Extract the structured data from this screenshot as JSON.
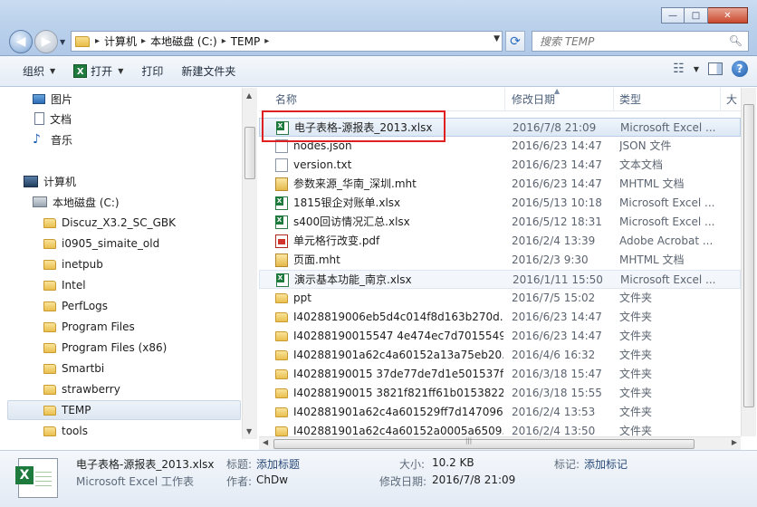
{
  "window": {
    "minimize_glyph": "—",
    "maximize_glyph": "□",
    "close_glyph": "✕"
  },
  "address": {
    "crumbs": [
      "计算机",
      "本地磁盘 (C:)",
      "TEMP"
    ],
    "separator": "▸"
  },
  "search": {
    "placeholder": "搜索 TEMP"
  },
  "toolbar": {
    "organize": "组织",
    "open": "打开",
    "print": "打印",
    "new_folder": "新建文件夹"
  },
  "nav": {
    "pictures": "图片",
    "documents": "文档",
    "music": "音乐",
    "computer": "计算机",
    "local_disk": "本地磁盘 (C:)",
    "folders": [
      "Discuz_X3.2_SC_GBK",
      "i0905_simaite_old",
      "inetpub",
      "Intel",
      "PerfLogs",
      "Program Files",
      "Program Files (x86)",
      "Smartbi",
      "strawberry",
      "TEMP",
      "tools"
    ]
  },
  "columns": {
    "name": "名称",
    "date": "修改日期",
    "type": "类型",
    "size": "大"
  },
  "files": [
    {
      "name": "电子表格-源报表_2013.xlsx",
      "date": "2016/7/8 21:09",
      "type": "Microsoft Excel ...",
      "icon": "excel-icon"
    },
    {
      "name": "nodes.json",
      "date": "2016/6/23 14:47",
      "type": "JSON 文件",
      "icon": "json-file-icon"
    },
    {
      "name": "version.txt",
      "date": "2016/6/23 14:47",
      "type": "文本文档",
      "icon": "text-file-icon"
    },
    {
      "name": "参数来源_华南_深圳.mht",
      "date": "2016/6/23 14:47",
      "type": "MHTML 文档",
      "icon": "mht-file-icon"
    },
    {
      "name": "1815银企对账单.xlsx",
      "date": "2016/5/13 10:18",
      "type": "Microsoft Excel ...",
      "icon": "excel-icon"
    },
    {
      "name": "s400回访情况汇总.xlsx",
      "date": "2016/5/12 18:31",
      "type": "Microsoft Excel ...",
      "icon": "excel-icon"
    },
    {
      "name": "单元格行改变.pdf",
      "date": "2016/2/4 13:39",
      "type": "Adobe Acrobat ...",
      "icon": "pdf-icon"
    },
    {
      "name": "页面.mht",
      "date": "2016/2/3 9:30",
      "type": "MHTML 文档",
      "icon": "mht-file-icon"
    },
    {
      "name": "演示基本功能_南京.xlsx",
      "date": "2016/1/11 15:50",
      "type": "Microsoft Excel ...",
      "icon": "excel-icon"
    },
    {
      "name": "ppt",
      "date": "2016/7/5 15:02",
      "type": "文件夹",
      "icon": "folder-icon"
    },
    {
      "name": "I4028819006eb5d4c014f8d163b270d...",
      "date": "2016/6/23 14:47",
      "type": "文件夹",
      "icon": "folder-icon"
    },
    {
      "name": "I40288190015547 4e474ec7d7015549...",
      "date": "2016/6/23 14:47",
      "type": "文件夹",
      "icon": "folder-icon"
    },
    {
      "name": "I402881901a62c4a60152a13a75eb20...",
      "date": "2016/4/6 16:32",
      "type": "文件夹",
      "icon": "folder-icon"
    },
    {
      "name": "I40288190015 37de77de7d1e501537f...",
      "date": "2016/3/18 15:47",
      "type": "文件夹",
      "icon": "folder-icon"
    },
    {
      "name": "I40288190015 3821f821ff61b0153822...",
      "date": "2016/3/18 15:55",
      "type": "文件夹",
      "icon": "folder-icon"
    },
    {
      "name": "I402881901a62c4a601529ff7d147096d",
      "date": "2016/2/4 13:53",
      "type": "文件夹",
      "icon": "folder-icon"
    },
    {
      "name": "I402881901a62c4a60152a0005a6509...",
      "date": "2016/2/4 13:50",
      "type": "文件夹",
      "icon": "folder-icon"
    }
  ],
  "details": {
    "filename": "电子表格-源报表_2013.xlsx",
    "filetype": "Microsoft Excel 工作表",
    "title_label": "标题:",
    "title_value": "添加标题",
    "author_label": "作者:",
    "author_value": "ChDw",
    "size_label": "大小:",
    "size_value": "10.2 KB",
    "modified_label": "修改日期:",
    "modified_value": "2016/7/8 21:09",
    "tags_label": "标记:",
    "tags_value": "添加标记"
  }
}
